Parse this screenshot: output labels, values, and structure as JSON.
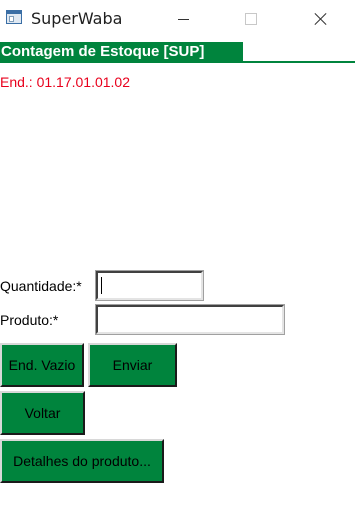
{
  "window": {
    "title": "SuperWaba"
  },
  "header": {
    "title": "Contagem de Estoque [SUP]"
  },
  "location": {
    "address": "End.: 01.17.01.01.02"
  },
  "form": {
    "quantity_label": "Quantidade:*",
    "quantity_value": "",
    "product_label": "Produto:*",
    "product_value": ""
  },
  "buttons": {
    "empty_address": "End. Vazio",
    "send": "Enviar",
    "back": "Voltar",
    "product_details": "Detalhes do produto..."
  },
  "colors": {
    "accent_green": "#00843d",
    "address_red": "#e8001c"
  },
  "icons": {
    "app": "window-app-icon",
    "minimize": "minimize-icon",
    "maximize": "maximize-icon",
    "close": "close-icon"
  }
}
